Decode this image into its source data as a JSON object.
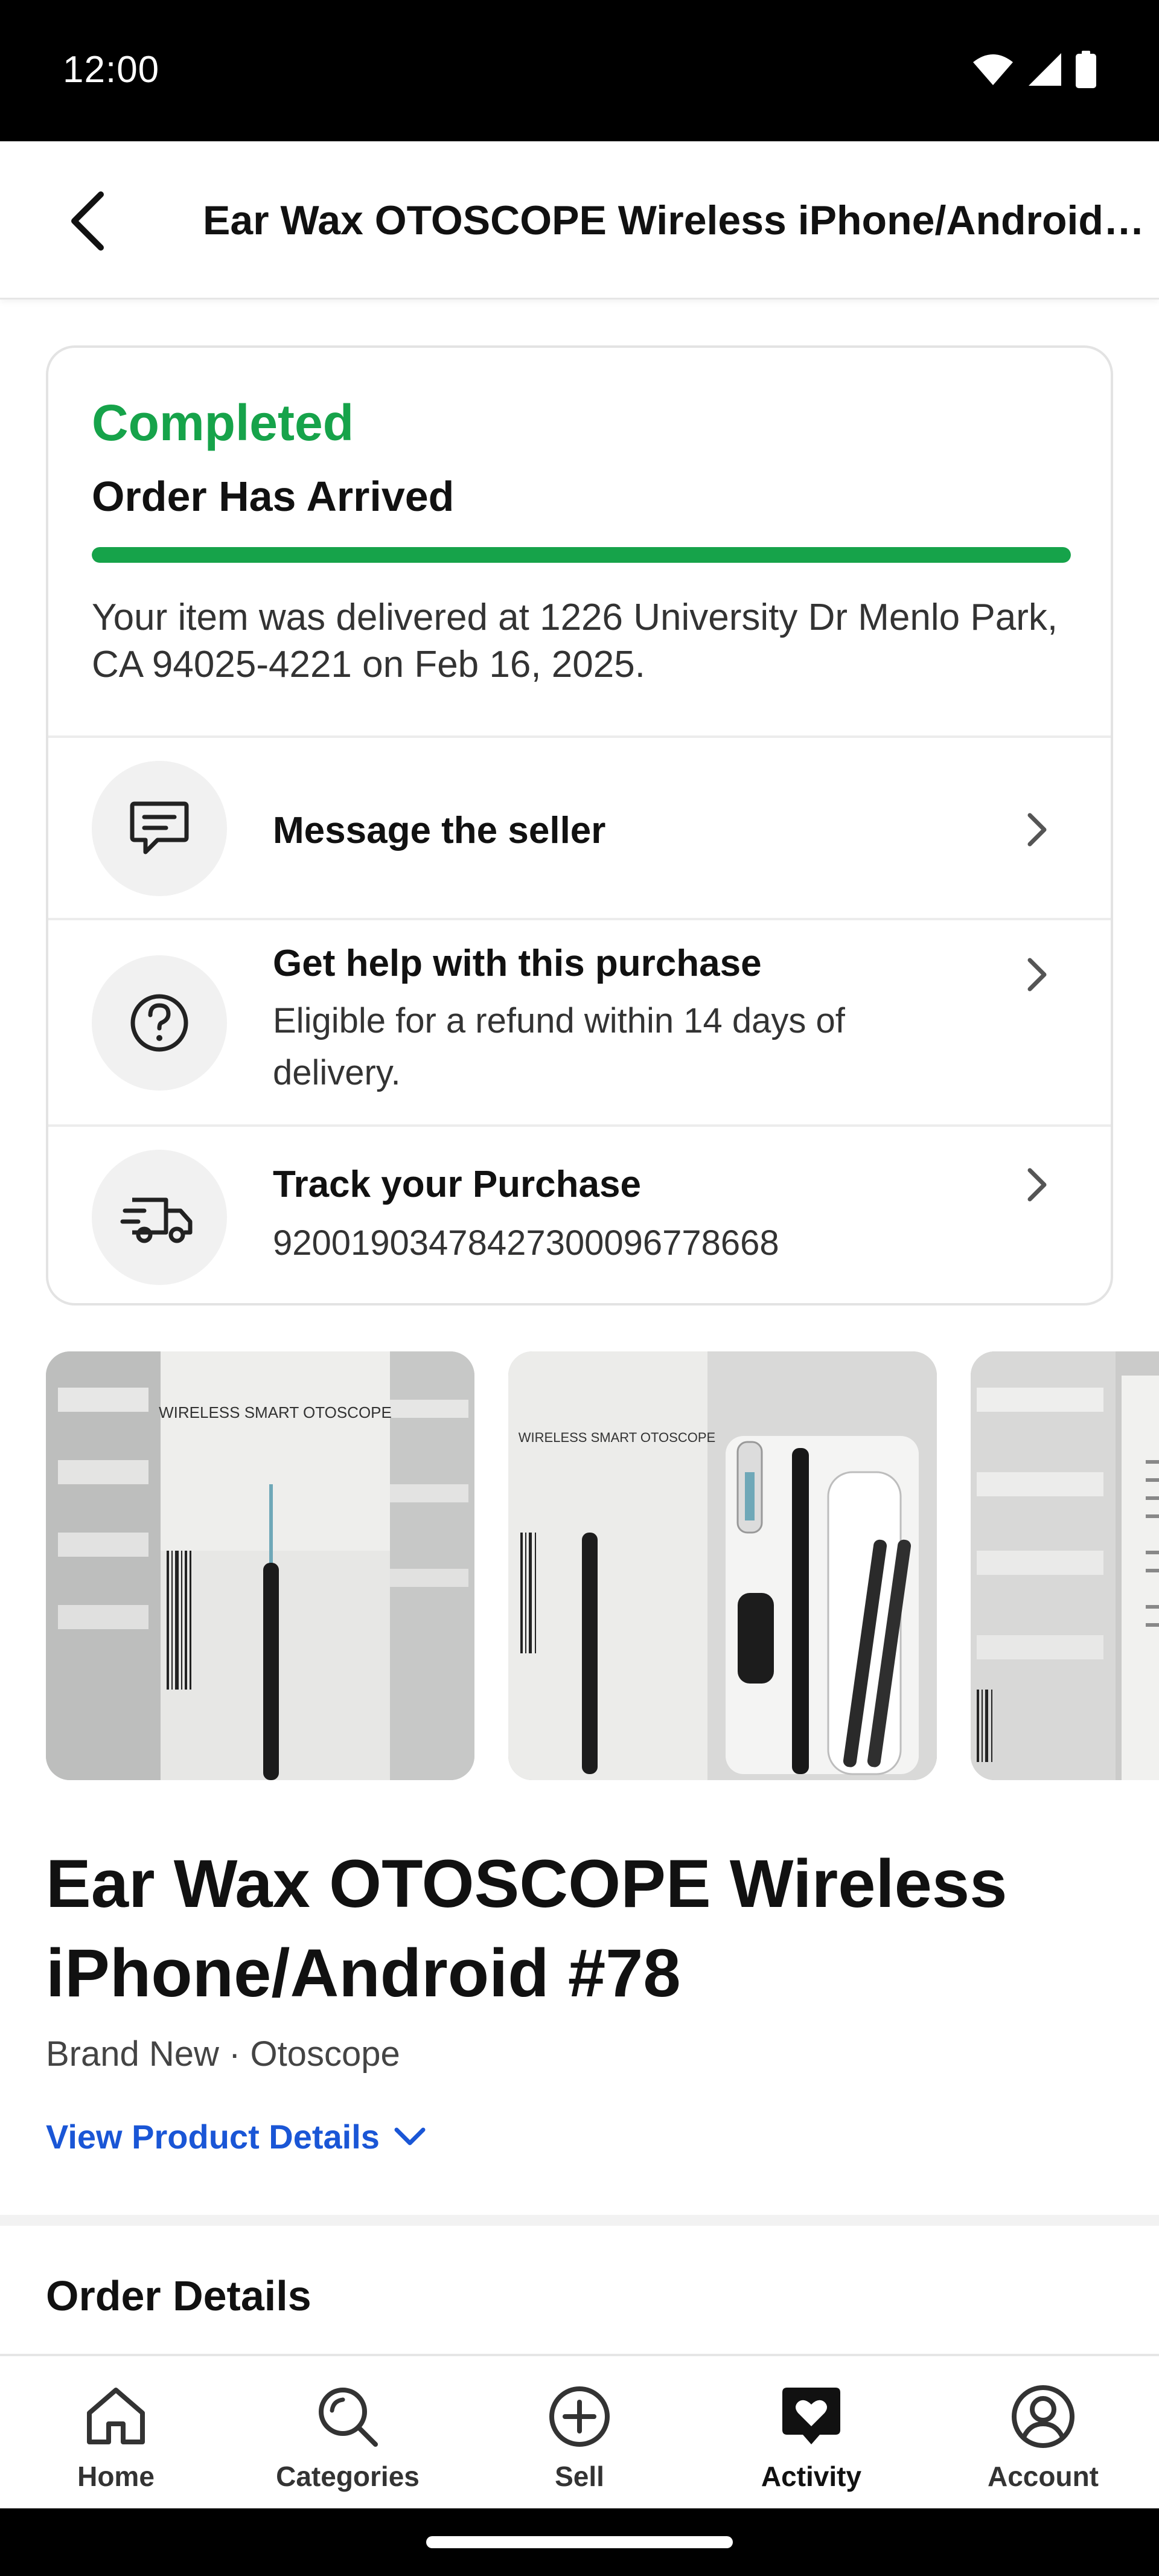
{
  "status_bar": {
    "time": "12:00"
  },
  "header": {
    "title": "Ear Wax OTOSCOPE Wireless iPhone/Android #78"
  },
  "order_status": {
    "label": "Completed",
    "heading": "Order Has Arrived",
    "progress_fraction": 1.0,
    "delivery_text": "Your item was delivered at 1226 University Dr Menlo Park, CA 94025-4221 on Feb 16, 2025.",
    "colors": {
      "status": "#16a34a"
    }
  },
  "actions": [
    {
      "title": "Message the seller",
      "icon": "message-icon"
    },
    {
      "title": "Get help with this purchase",
      "subtitle": "Eligible for a refund within 14 days of delivery.",
      "icon": "help-icon"
    },
    {
      "title": "Track your Purchase",
      "subtitle": "92001903478427300096778668",
      "icon": "truck-icon"
    }
  ],
  "photos": [
    {
      "box_text": "WIRELESS SMART OTOSCOPE"
    },
    {
      "box_text": "WIRELESS SMART OTOSCOPE"
    },
    {
      "box_text": ""
    }
  ],
  "product": {
    "title": "Ear Wax OTOSCOPE Wireless iPhone/Android #78",
    "meta": "Brand New · Otoscope",
    "view_details": "View Product Details"
  },
  "order_details": {
    "title": "Order Details"
  },
  "bottom_nav": [
    {
      "label": "Home",
      "icon": "home-icon"
    },
    {
      "label": "Categories",
      "icon": "search-icon"
    },
    {
      "label": "Sell",
      "icon": "plus-circle-icon"
    },
    {
      "label": "Activity",
      "icon": "heart-message-icon",
      "active": true
    },
    {
      "label": "Account",
      "icon": "account-icon"
    }
  ]
}
